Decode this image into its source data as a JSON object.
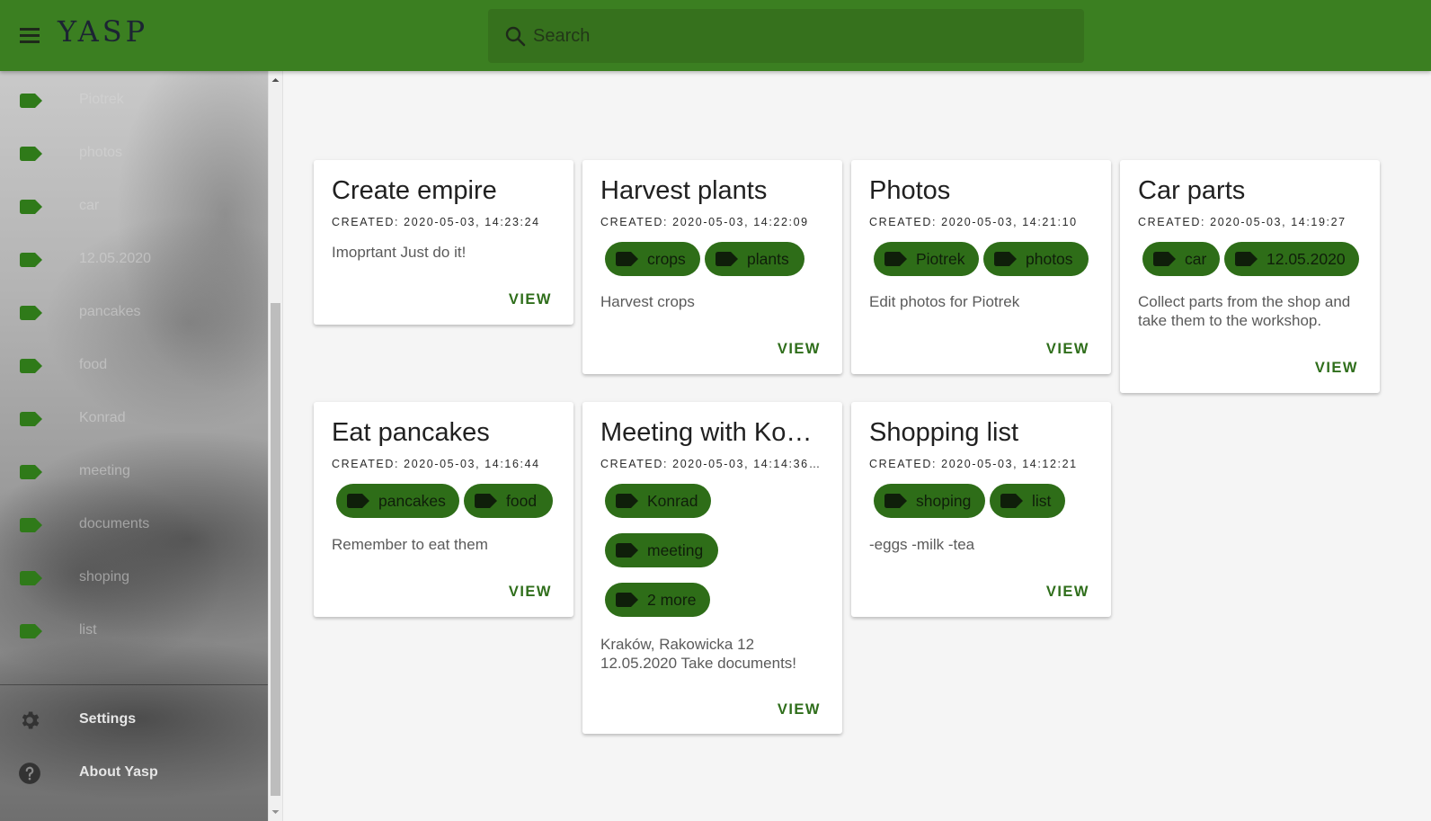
{
  "app": {
    "logo": "YASP",
    "search_placeholder": "Search",
    "accent_color": "#3b7f21",
    "chip_color": "#2e6d18"
  },
  "sidebar": {
    "items": [
      {
        "label": "Piotrek",
        "icon": "tag-icon"
      },
      {
        "label": "photos",
        "icon": "tag-icon"
      },
      {
        "label": "car",
        "icon": "tag-icon"
      },
      {
        "label": "12.05.2020",
        "icon": "tag-icon"
      },
      {
        "label": "pancakes",
        "icon": "tag-icon"
      },
      {
        "label": "food",
        "icon": "tag-icon"
      },
      {
        "label": "Konrad",
        "icon": "tag-icon"
      },
      {
        "label": "meeting",
        "icon": "tag-icon"
      },
      {
        "label": "documents",
        "icon": "tag-icon"
      },
      {
        "label": "shoping",
        "icon": "tag-icon"
      },
      {
        "label": "list",
        "icon": "tag-icon"
      }
    ],
    "settings_label": "Settings",
    "about_label": "About Yasp"
  },
  "notes": [
    {
      "title": "Create empire",
      "created": "CREATED: 2020-05-03, 14:23:24",
      "tags": [],
      "body": "Imoprtant Just do it!",
      "view": "VIEW"
    },
    {
      "title": "Harvest plants",
      "created": "CREATED: 2020-05-03, 14:22:09",
      "tags": [
        "crops",
        "plants"
      ],
      "body": "Harvest crops",
      "view": "VIEW"
    },
    {
      "title": "Photos",
      "created": "CREATED: 2020-05-03, 14:21:10",
      "tags": [
        "Piotrek",
        "photos"
      ],
      "body": "Edit photos for Piotrek",
      "view": "VIEW"
    },
    {
      "title": "Car parts",
      "created": "CREATED: 2020-05-03, 14:19:27",
      "tags": [
        "car",
        "12.05.2020"
      ],
      "body_line1": "Collect parts from the shop and",
      "body_line2": "take them to the workshop.",
      "view": "VIEW"
    },
    {
      "title": "Eat pancakes",
      "created": "CREATED: 2020-05-03, 14:16:44",
      "tags": [
        "pancakes",
        "food"
      ],
      "body": "Remember to eat them",
      "view": "VIEW"
    },
    {
      "title": "Meeting with Ko…",
      "created": "CREATED: 2020-05-03, 14:14:36…",
      "tags": [
        "Konrad",
        "meeting",
        "2 more"
      ],
      "body_line1": "Kraków, Rakowicka 12",
      "body_line2": "12.05.2020 Take documents!",
      "view": "VIEW"
    },
    {
      "title": "Shopping list",
      "created": "CREATED: 2020-05-03, 14:12:21",
      "tags": [
        "shoping",
        "list"
      ],
      "body": "-eggs -milk -tea",
      "view": "VIEW"
    }
  ]
}
